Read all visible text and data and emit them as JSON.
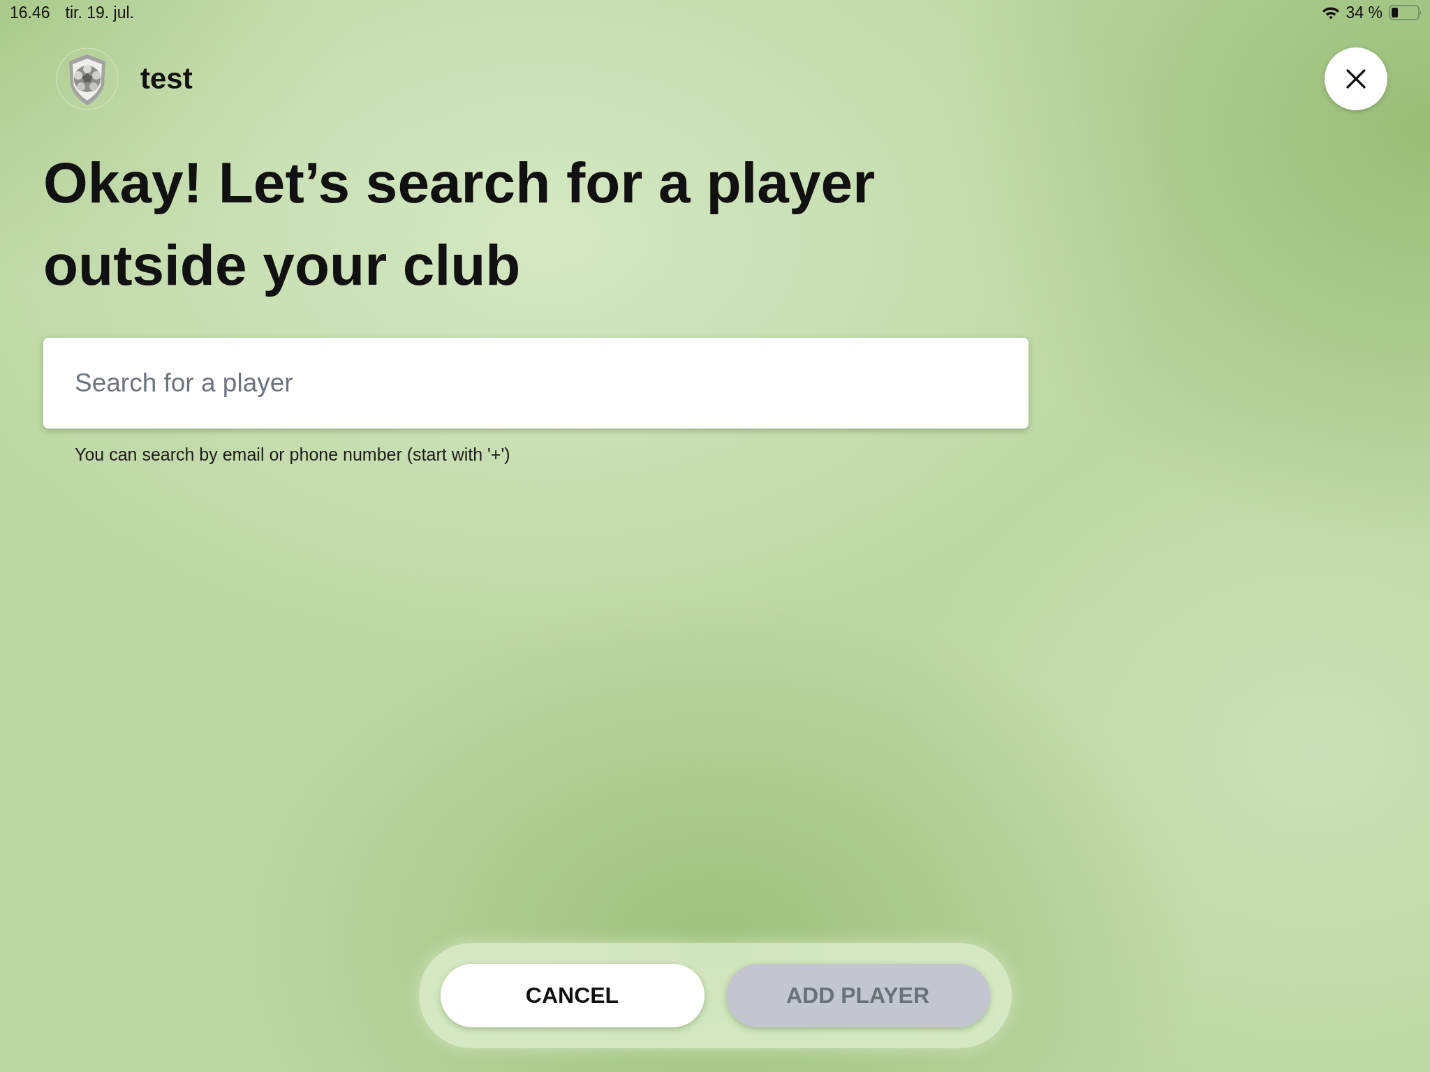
{
  "status_bar": {
    "time": "16.46",
    "date": "tir. 19. jul.",
    "battery_percent": "34 %"
  },
  "header": {
    "team_name": "test"
  },
  "heading": "Okay! Let’s search for a player outside your club",
  "search": {
    "placeholder": "Search for a player",
    "hint": "You can search by email or phone number (start with '+')"
  },
  "buttons": [
    {
      "label": "CANCEL",
      "disabled": false
    },
    {
      "label": "ADD PLAYER",
      "disabled": true
    }
  ]
}
